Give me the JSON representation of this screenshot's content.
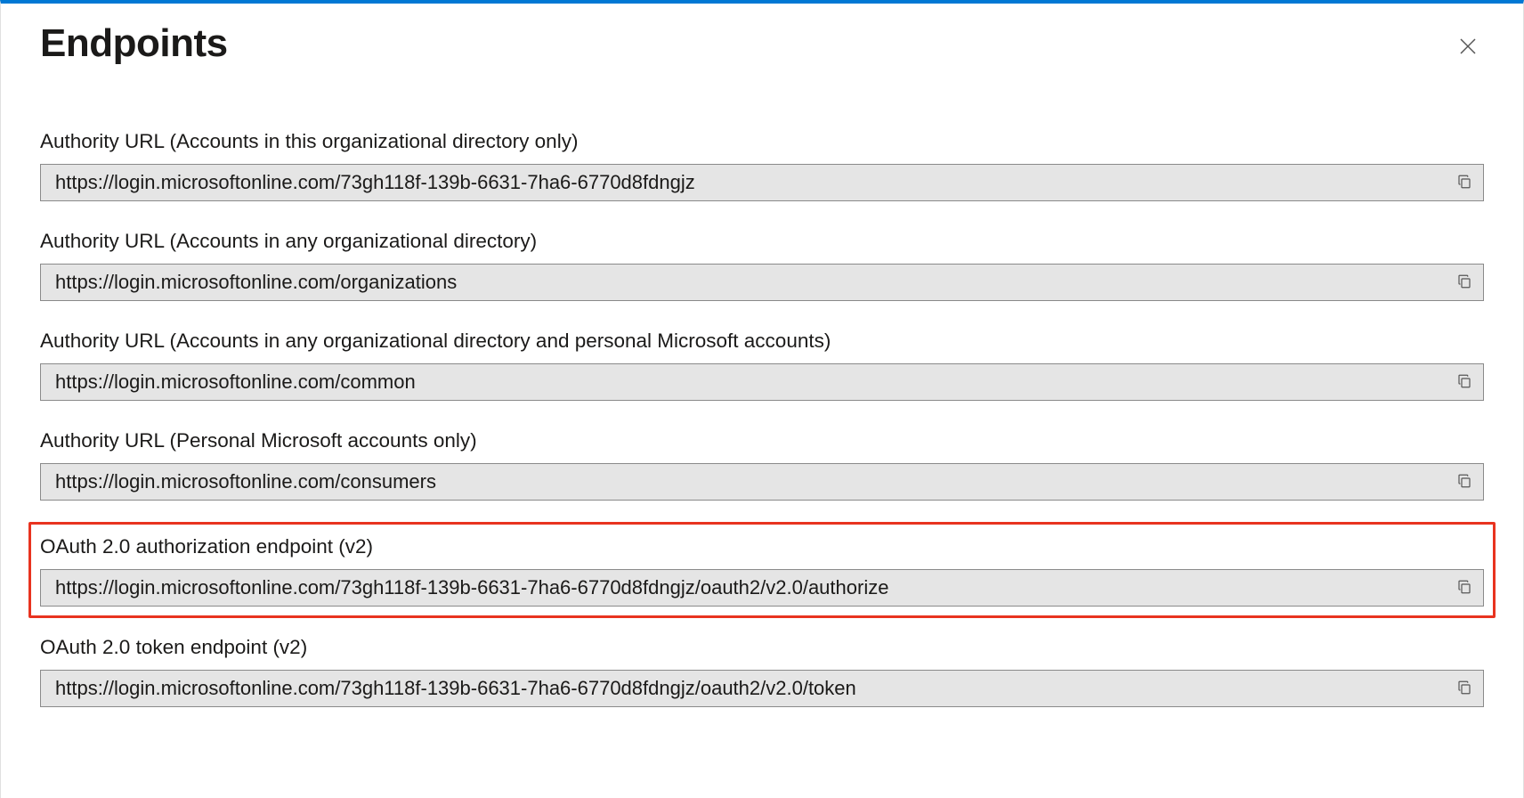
{
  "title": "Endpoints",
  "fields": [
    {
      "label": "Authority URL (Accounts in this organizational directory only)",
      "value": "https://login.microsoftonline.com/73gh118f-139b-6631-7ha6-6770d8fdngjz",
      "highlighted": false
    },
    {
      "label": "Authority URL (Accounts in any organizational directory)",
      "value": "https://login.microsoftonline.com/organizations",
      "highlighted": false
    },
    {
      "label": "Authority URL (Accounts in any organizational directory and personal Microsoft accounts)",
      "value": "https://login.microsoftonline.com/common",
      "highlighted": false
    },
    {
      "label": "Authority URL (Personal Microsoft accounts only)",
      "value": "https://login.microsoftonline.com/consumers",
      "highlighted": false
    },
    {
      "label": "OAuth 2.0 authorization endpoint (v2)",
      "value": "https://login.microsoftonline.com/73gh118f-139b-6631-7ha6-6770d8fdngjz/oauth2/v2.0/authorize",
      "highlighted": true
    },
    {
      "label": "OAuth 2.0 token endpoint (v2)",
      "value": "https://login.microsoftonline.com/73gh118f-139b-6631-7ha6-6770d8fdngjz/oauth2/v2.0/token",
      "highlighted": false
    }
  ]
}
